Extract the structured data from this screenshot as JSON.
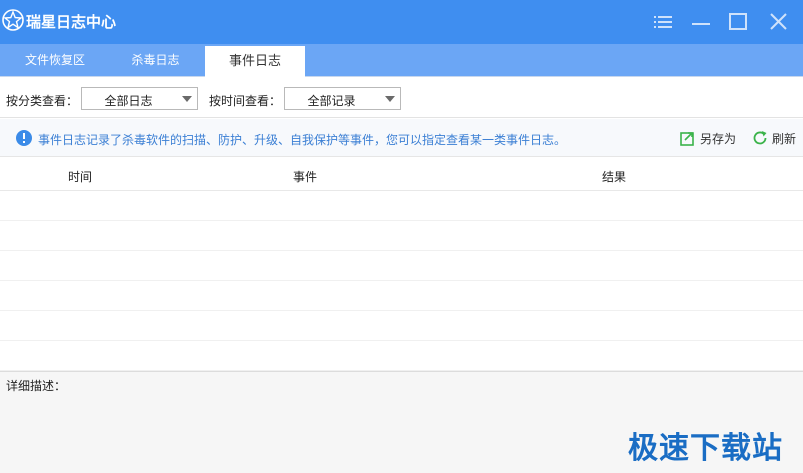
{
  "window": {
    "title": "瑞星日志中心",
    "icons": {
      "logo": "rising-star-logo-icon",
      "menu": "menu-lines-icon",
      "minimize": "minimize-icon",
      "maximize": "maximize-icon",
      "close": "close-icon"
    }
  },
  "tabs": [
    {
      "label": "文件恢复区",
      "active": false
    },
    {
      "label": "杀毒日志",
      "active": false
    },
    {
      "label": "事件日志",
      "active": true
    }
  ],
  "filters": {
    "category_label": "按分类查看：",
    "category_value": "全部日志",
    "time_label": "按时间查看：",
    "time_value": "全部记录"
  },
  "info": {
    "icon": "info-circle-icon",
    "text": "事件日志记录了杀毒软件的扫描、防护、升级、自我保护等事件，您可以指定查看某一类事件日志。",
    "save_as": "另存为",
    "refresh": "刷新"
  },
  "table": {
    "columns": [
      "时间",
      "事件",
      "结果"
    ],
    "rows": []
  },
  "detail": {
    "label": "详细描述："
  },
  "watermark": "极速下载站",
  "colors": {
    "titlebar": "#3f8ef0",
    "tabbar": "#6ba6f5",
    "info_text": "#3b7fd4",
    "refresh_icon": "#3bb34a",
    "save_icon": "#3bb34a"
  }
}
